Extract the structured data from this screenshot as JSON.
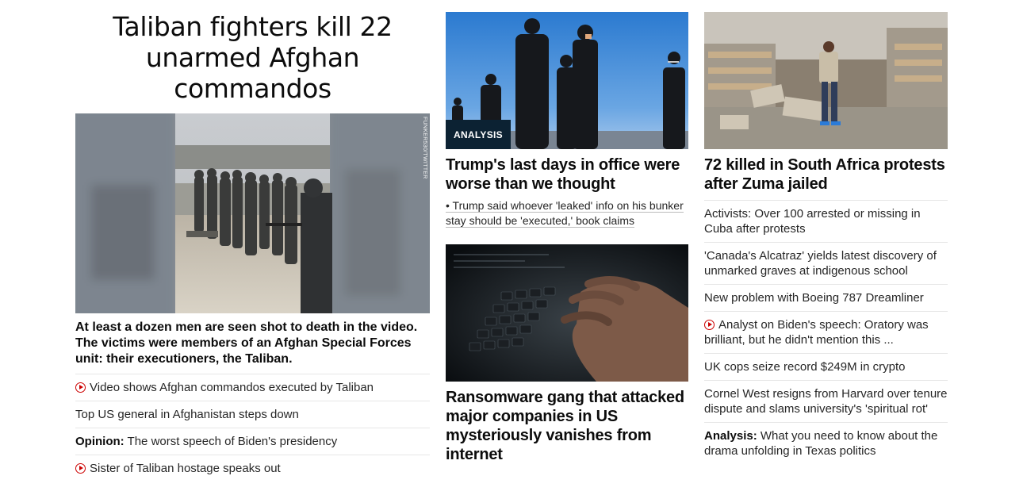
{
  "left": {
    "headline": "Taliban fighters kill 22 unarmed Afghan commandos",
    "image_credit": "FUNKER530/TWITTER",
    "summary": "At least a dozen men are seen shot to death in the video. The victims were members of an Afghan Special Forces unit: their executioners, the Taliban.",
    "links": [
      {
        "text": "Video shows Afghan commandos executed by Taliban",
        "video": true
      },
      {
        "text": "Top US general in Afghanistan steps down"
      },
      {
        "prefix": "Opinion:",
        "text": " The worst speech of Biden's presidency"
      },
      {
        "text": "Sister of Taliban hostage speaks out",
        "video": true
      }
    ]
  },
  "middle": {
    "card1": {
      "tag": "ANALYSIS",
      "title": "Trump's last days in office were worse than we thought",
      "bullet": "• Trump said whoever 'leaked' info on his bunker stay should be 'executed,' book claims"
    },
    "card2": {
      "title": "Ransomware gang that attacked major companies in US mysteriously vanishes from internet"
    }
  },
  "right": {
    "title": "72 killed in South Africa protests after Zuma jailed",
    "links": [
      {
        "text": "Activists: Over 100 arrested or missing in Cuba after protests"
      },
      {
        "text": "'Canada's Alcatraz' yields latest discovery of unmarked graves at indigenous school"
      },
      {
        "text": "New problem with Boeing 787 Dreamliner"
      },
      {
        "text": "Analyst on Biden's speech: Oratory was brilliant, but he didn't mention this ...",
        "video": true
      },
      {
        "text": "UK cops seize record $249M in crypto"
      },
      {
        "text": "Cornel West resigns from Harvard over tenure dispute and slams university's 'spiritual rot'"
      },
      {
        "prefix": "Analysis:",
        "text": " What you need to know about the drama unfolding in Texas politics"
      }
    ]
  },
  "colors": {
    "video_red": "#cc0000",
    "tag_bg": "#0c2233",
    "divider": "#e6e6e6"
  }
}
